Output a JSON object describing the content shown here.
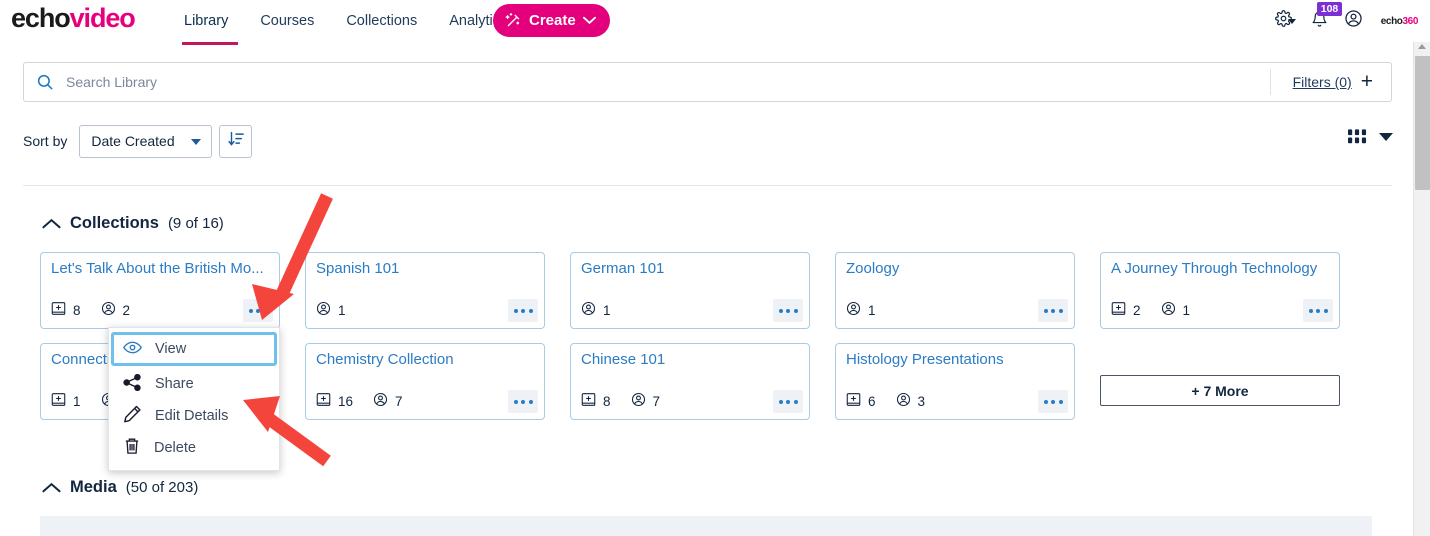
{
  "brand": {
    "logo_echo": "echo",
    "logo_video": "video",
    "corner_logo_main": "echo",
    "corner_logo_accent": "360",
    "accent_pink": "#e4007c",
    "link_blue": "#2b7cc4",
    "focus_blue": "#6fc0ea",
    "badge_purple": "#7b2fd4",
    "arrow_red": "#f4453c"
  },
  "topnav": {
    "links": [
      {
        "label": "Library",
        "active": true
      },
      {
        "label": "Courses",
        "active": false
      },
      {
        "label": "Collections",
        "active": false
      },
      {
        "label": "Analytics",
        "active": false
      }
    ],
    "create_label": "Create",
    "settings_icon": "gear-icon",
    "notifications_icon": "bell-icon",
    "notifications_count": "108",
    "account_icon": "user-circle-icon"
  },
  "search": {
    "placeholder": "Search Library",
    "value": "",
    "icon": "search-icon",
    "filters_label": "Filters (0)",
    "filters_plus": "+"
  },
  "toolbar": {
    "sort_by_label": "Sort by",
    "sort_value": "Date Created",
    "sort_options": [
      "Date Created"
    ],
    "sort_direction_icon": "sort-descending-icon",
    "grid_view_icon": "grid-view-icon",
    "view_chevron_icon": "chevron-down-icon"
  },
  "sections": {
    "collections": {
      "title": "Collections",
      "count": "(9 of 16)",
      "collapse_icon": "chevron-up-icon",
      "more_button": "+ 7 More"
    },
    "media": {
      "title": "Media",
      "count": "(50 of 203)",
      "collapse_icon": "chevron-up-icon"
    }
  },
  "collections": [
    [
      {
        "title": "Let's Talk About the British Mo...",
        "media": "8",
        "users": "2",
        "has_media": true
      },
      {
        "title": "Spanish 101",
        "media": "",
        "users": "1",
        "has_media": false
      },
      {
        "title": "German 101",
        "media": "",
        "users": "1",
        "has_media": false
      },
      {
        "title": "Zoology",
        "media": "",
        "users": "1",
        "has_media": false
      },
      {
        "title": "A Journey Through Technology",
        "media": "2",
        "users": "1",
        "has_media": true
      }
    ],
    [
      {
        "title": "Connecti",
        "media": "1",
        "users": "",
        "has_media": true
      },
      {
        "title": "Chemistry Collection",
        "media": "16",
        "users": "7",
        "has_media": true
      },
      {
        "title": "Chinese 101",
        "media": "8",
        "users": "7",
        "has_media": true
      },
      {
        "title": "Histology Presentations",
        "media": "6",
        "users": "3",
        "has_media": true
      }
    ]
  ],
  "context_menu": {
    "items": [
      {
        "label": "View",
        "icon": "eye-icon",
        "focused": true
      },
      {
        "label": "Share",
        "icon": "share-icon",
        "focused": false
      },
      {
        "label": "Edit Details",
        "icon": "pencil-icon",
        "focused": false
      },
      {
        "label": "Delete",
        "icon": "trash-icon",
        "focused": false
      }
    ]
  },
  "scrollbar": {
    "up_icon": "scroll-up-arrow-icon"
  }
}
